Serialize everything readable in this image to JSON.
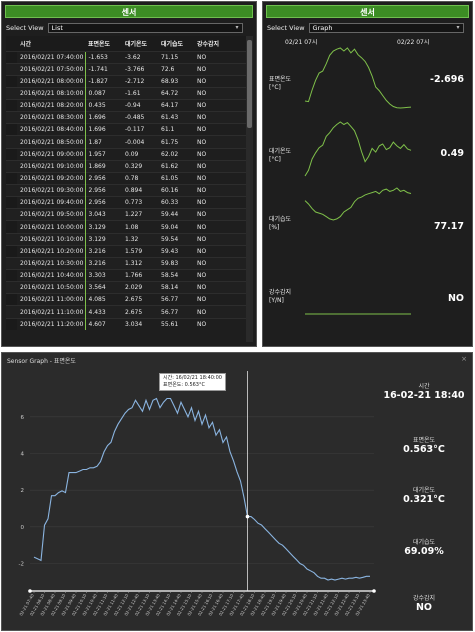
{
  "list_panel": {
    "title": "센서",
    "select_view_label": "Select View",
    "select_view_value": "List",
    "columns": [
      "시간",
      "표면온도",
      "대기온도",
      "대기습도",
      "강수감지"
    ],
    "rows": [
      [
        "2016/02/21 07:40:00",
        "-1.653",
        "-3.62",
        "71.15",
        "NO"
      ],
      [
        "2016/02/21 07:50:00",
        "-1.741",
        "-3.766",
        "72.6",
        "NO"
      ],
      [
        "2016/02/21 08:00:00",
        "-1.827",
        "-2.712",
        "68.93",
        "NO"
      ],
      [
        "2016/02/21 08:10:00",
        "0.087",
        "-1.61",
        "64.72",
        "NO"
      ],
      [
        "2016/02/21 08:20:00",
        "0.435",
        "-0.94",
        "64.17",
        "NO"
      ],
      [
        "2016/02/21 08:30:00",
        "1.696",
        "-0.485",
        "61.43",
        "NO"
      ],
      [
        "2016/02/21 08:40:00",
        "1.696",
        "-0.117",
        "61.1",
        "NO"
      ],
      [
        "2016/02/21 08:50:00",
        "1.87",
        "-0.004",
        "61.75",
        "NO"
      ],
      [
        "2016/02/21 09:00:00",
        "1.957",
        "0.09",
        "62.02",
        "NO"
      ],
      [
        "2016/02/21 09:10:00",
        "1.869",
        "0.329",
        "61.62",
        "NO"
      ],
      [
        "2016/02/21 09:20:00",
        "2.956",
        "0.78",
        "61.05",
        "NO"
      ],
      [
        "2016/02/21 09:30:00",
        "2.956",
        "0.894",
        "60.16",
        "NO"
      ],
      [
        "2016/02/21 09:40:00",
        "2.956",
        "0.773",
        "60.33",
        "NO"
      ],
      [
        "2016/02/21 09:50:00",
        "3.043",
        "1.227",
        "59.44",
        "NO"
      ],
      [
        "2016/02/21 10:00:00",
        "3.129",
        "1.08",
        "59.04",
        "NO"
      ],
      [
        "2016/02/21 10:10:00",
        "3.129",
        "1.32",
        "59.54",
        "NO"
      ],
      [
        "2016/02/21 10:20:00",
        "3.216",
        "1.579",
        "59.43",
        "NO"
      ],
      [
        "2016/02/21 10:30:00",
        "3.216",
        "1.312",
        "59.83",
        "NO"
      ],
      [
        "2016/02/21 10:40:00",
        "3.303",
        "1.766",
        "58.54",
        "NO"
      ],
      [
        "2016/02/21 10:50:00",
        "3.564",
        "2.029",
        "58.14",
        "NO"
      ],
      [
        "2016/02/21 11:00:00",
        "4.085",
        "2.675",
        "56.77",
        "NO"
      ],
      [
        "2016/02/21 11:10:00",
        "4.433",
        "2.675",
        "56.77",
        "NO"
      ],
      [
        "2016/02/21 11:20:00",
        "4.607",
        "3.034",
        "55.61",
        "NO"
      ]
    ]
  },
  "graph_panel": {
    "title": "센서",
    "select_view_label": "Select View",
    "select_view_value": "Graph",
    "start_label": "02/21 07시",
    "end_label": "02/22 07시",
    "sensors": [
      {
        "label": "표면온도",
        "unit": "[°C]",
        "value": "-2.696"
      },
      {
        "label": "대기온도",
        "unit": "[°C]",
        "value": "0.49"
      },
      {
        "label": "대기습도",
        "unit": "[%]",
        "value": "77.17"
      },
      {
        "label": "강수감지",
        "unit": "[Y/N]",
        "value": "NO"
      }
    ]
  },
  "sensor_graph": {
    "window_title": "Sensor Graph - 표면온도",
    "close_glyph": "×",
    "tooltip_line1": "시간: 16/02/21 18:40:00",
    "tooltip_line2": "표면온도: 0.563°C",
    "readouts": [
      {
        "label": "시간",
        "value": "16-02-21 18:40"
      },
      {
        "label": "표면온도",
        "value": "0.563°C"
      },
      {
        "label": "대기온도",
        "value": "0.321°C"
      },
      {
        "label": "대기습도",
        "value": "69.09%"
      },
      {
        "label": "강수감지",
        "value": "NO"
      }
    ]
  },
  "chart_data": {
    "type": "line",
    "series": [
      {
        "values": [
          -1.65,
          -1.74,
          -1.83,
          0.09,
          0.44,
          1.7,
          1.7,
          1.87,
          1.96,
          1.87,
          2.96,
          2.96,
          2.96,
          3.04,
          3.13,
          3.13,
          3.22,
          3.22,
          3.3,
          3.56,
          4.09,
          4.43,
          4.61,
          5.2,
          5.6,
          5.9,
          6.2,
          6.4,
          6.5,
          6.9,
          6.6,
          6.3,
          6.9,
          6.4,
          6.9,
          7.0,
          6.5,
          6.8,
          7.0,
          7.0,
          6.6,
          6.2,
          6.8,
          6.4,
          6.0,
          6.5,
          5.8,
          6.3,
          5.6,
          6.1,
          5.4,
          5.7,
          5.0,
          5.3,
          4.6,
          4.9,
          4.1,
          3.6,
          3.0,
          2.5,
          1.6,
          0.56,
          0.56,
          0.4,
          0.2,
          0.1,
          -0.1,
          -0.3,
          -0.5,
          -0.7,
          -0.9,
          -1.0,
          -1.2,
          -1.4,
          -1.6,
          -1.8,
          -2.0,
          -2.1,
          -2.3,
          -2.4,
          -2.5,
          -2.7,
          -2.8,
          -2.8,
          -2.9,
          -2.85,
          -2.9,
          -2.85,
          -2.8,
          -2.85,
          -2.8,
          -2.8,
          -2.75,
          -2.8,
          -2.75,
          -2.7,
          -2.7
        ]
      }
    ],
    "x_tick_labels": [
      "02-21 07:40",
      "02-21 08:10",
      "02-21 08:40",
      "02-21 09:10",
      "02-21 09:40",
      "02-21 10:10",
      "02-21 10:40",
      "02-21 11:10",
      "02-21 11:40",
      "02-21 12:10",
      "02-21 12:40",
      "02-21 13:10",
      "02-21 13:40",
      "02-21 14:10",
      "02-21 14:40",
      "02-21 15:10",
      "02-21 15:40",
      "02-21 16:10",
      "02-21 16:40",
      "02-21 17:10",
      "02-21 17:40",
      "02-21 18:10",
      "02-21 18:40",
      "02-21 19:10",
      "02-21 19:40",
      "02-21 20:10",
      "02-21 20:40",
      "02-21 21:10",
      "02-21 21:40",
      "02-21 22:10",
      "02-21 22:40",
      "02-21 23:10",
      "02-21 23:40"
    ],
    "y_ticks": [
      -2,
      0,
      2,
      4,
      6
    ],
    "ylim": [
      -3.5,
      8.5
    ],
    "cursor_index": 61,
    "line_color": "#8ab4e0",
    "grid": true
  },
  "mini_charts": [
    {
      "color": "#7fc04a",
      "values": [
        -1.7,
        -1.8,
        0.1,
        1.7,
        2.9,
        3.2,
        4.4,
        5.8,
        6.5,
        6.8,
        7.0,
        6.5,
        7.0,
        6.2,
        6.8,
        5.9,
        5.4,
        4.8,
        3.8,
        2.4,
        0.6,
        0.0,
        -0.8,
        -1.6,
        -2.2,
        -2.6,
        -2.8,
        -2.85,
        -2.8,
        -2.75,
        -2.7
      ]
    },
    {
      "color": "#7fc04a",
      "values": [
        -3.6,
        -2.7,
        -0.9,
        0.1,
        0.9,
        1.3,
        2.7,
        3.3,
        4.1,
        4.6,
        5.0,
        4.6,
        4.9,
        4.3,
        3.6,
        2.2,
        0.3,
        -1.3,
        -0.5,
        0.8,
        0.2,
        1.2,
        1.5,
        0.6,
        0.9,
        1.8,
        1.2,
        0.8,
        1.4,
        0.7,
        0.49
      ]
    },
    {
      "color": "#7fc04a",
      "values": [
        71,
        68,
        64,
        61,
        60,
        59,
        57,
        55,
        54,
        55,
        57,
        61,
        63,
        65,
        70,
        73,
        74,
        76,
        77,
        78,
        79,
        77,
        80,
        81,
        79,
        80,
        82,
        79,
        80,
        78,
        77.2
      ]
    },
    {
      "color": "#7fc04a",
      "values": [
        0,
        0,
        0,
        0,
        0,
        0,
        0,
        0,
        0,
        0,
        0,
        0,
        0,
        0,
        0,
        0,
        0,
        0,
        0,
        0,
        0,
        0,
        0,
        0,
        0,
        0,
        0,
        0,
        0,
        0,
        0
      ]
    }
  ]
}
